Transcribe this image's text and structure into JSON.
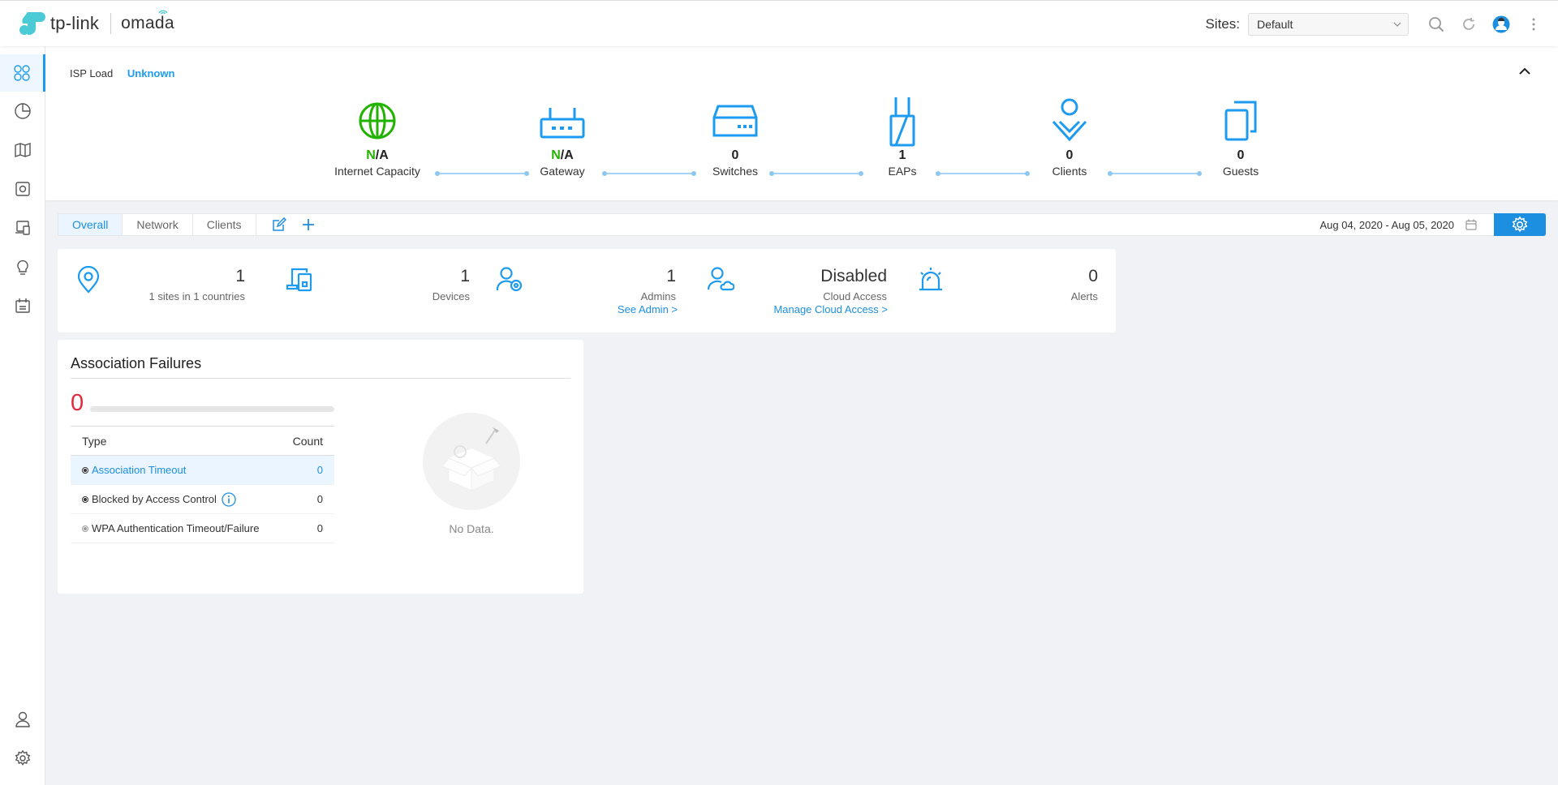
{
  "header": {
    "brand": "tp-link",
    "product": "omada",
    "sites_label": "Sites:",
    "site_selected": "Default"
  },
  "topology": {
    "isp_label": "ISP Load",
    "isp_value": "Unknown",
    "nodes": [
      {
        "value_first": "N",
        "value_rest": "/A",
        "label": "Internet Capacity",
        "icon": "globe-icon"
      },
      {
        "value_first": "N",
        "value_rest": "/A",
        "label": "Gateway",
        "icon": "gateway-icon"
      },
      {
        "value": "0",
        "label": "Switches",
        "icon": "switch-icon"
      },
      {
        "value": "1",
        "label": "EAPs",
        "icon": "eap-icon"
      },
      {
        "value": "0",
        "label": "Clients",
        "icon": "client-icon"
      },
      {
        "value": "0",
        "label": "Guests",
        "icon": "guest-icon"
      }
    ]
  },
  "tabs": [
    {
      "label": "Overall",
      "active": true
    },
    {
      "label": "Network"
    },
    {
      "label": "Clients"
    }
  ],
  "date_range": "Aug 04, 2020 - Aug 05, 2020",
  "summary": {
    "sites": {
      "value": "1",
      "label": "1 sites in 1 countries"
    },
    "devices": {
      "value": "1",
      "label": "Devices"
    },
    "admins": {
      "value": "1",
      "label": "Admins",
      "link": "See Admin >"
    },
    "cloud": {
      "value": "Disabled",
      "label": "Cloud Access",
      "link": "Manage Cloud Access >"
    },
    "alerts": {
      "value": "0",
      "label": "Alerts"
    }
  },
  "assoc_failures": {
    "title": "Association Failures",
    "total": "0",
    "col_type": "Type",
    "col_count": "Count",
    "rows": [
      {
        "type": "Association Timeout",
        "count": "0"
      },
      {
        "type": "Blocked by Access Control",
        "count": "0"
      },
      {
        "type": "WPA Authentication Timeout/Failure",
        "count": "0"
      }
    ],
    "no_data": "No Data."
  },
  "colors": {
    "accent": "#1c9bf0",
    "green": "#22b300",
    "red": "#e6283c"
  }
}
